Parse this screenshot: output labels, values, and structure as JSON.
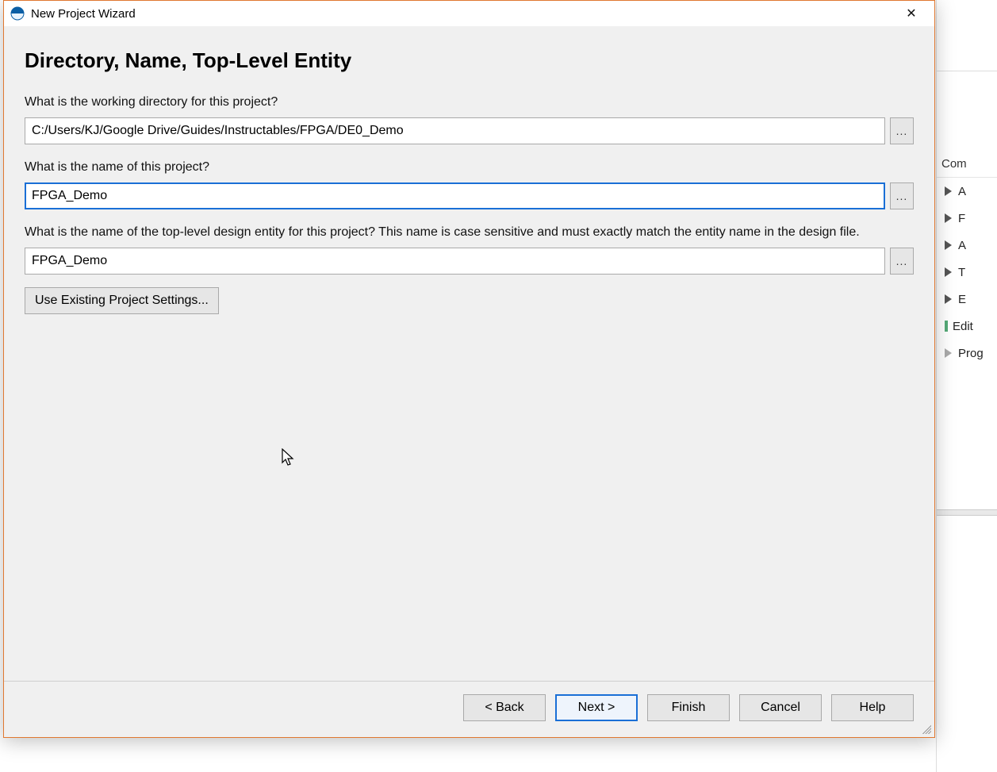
{
  "window": {
    "title": "New Project Wizard",
    "close_glyph": "✕"
  },
  "page": {
    "heading": "Directory, Name, Top-Level Entity",
    "q_directory": "What is the working directory for this project?",
    "directory_value": "C:/Users/KJ/Google Drive/Guides/Instructables/FPGA/DE0_Demo",
    "q_name": "What is the name of this project?",
    "name_value": "FPGA_Demo",
    "q_entity": "What is the name of the top-level design entity for this project? This name is case sensitive and must exactly match the entity name in the design file.",
    "entity_value": "FPGA_Demo",
    "browse_glyph": "...",
    "use_existing_label": "Use Existing Project Settings..."
  },
  "footer": {
    "back": "< Back",
    "next": "Next >",
    "finish": "Finish",
    "cancel": "Cancel",
    "help": "Help"
  },
  "background_panel": {
    "header": "Com",
    "items": [
      "A",
      "F",
      "A",
      "T",
      "E"
    ],
    "edit": "Edit",
    "prog": "Prog"
  }
}
